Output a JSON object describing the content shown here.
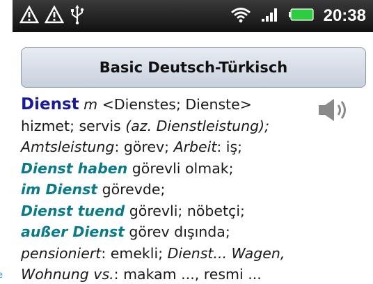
{
  "statusbar": {
    "time": "20:38"
  },
  "left_edge_fragment": "e",
  "app": {
    "title": "Basic Deutsch-Türkisch"
  },
  "entry": {
    "headword": "Dienst",
    "gender": "m",
    "forms": " <Dienstes; Dienste>",
    "l1_a": "hizmet; servis ",
    "l1_b": "(az. Dienstleistung);",
    "l2_a": "Amtsleistung",
    "l2_b": ": görev; ",
    "l2_c": "Arbeit",
    "l2_d": ": iş;",
    "p1": "Dienst haben",
    "p1_t": " görevli olmak;",
    "p2": "im Dienst",
    "p2_t": " görevde;",
    "p3": "Dienst tuend",
    "p3_t": " görevli; nöbetçi;",
    "p4": "außer Dienst",
    "p4_t": " görev dışında;",
    "l7_a": "pensioniert",
    "l7_b": ": emekli; ",
    "l7_c": "Dienst... Wagen,",
    "l8_a": "Wohnung vs.",
    "l8_b": ": makam ..., resmi ..."
  },
  "icons": {
    "status_left": [
      "warning-icon",
      "warning-icon",
      "usb-icon"
    ],
    "status_right": [
      "wifi-icon",
      "signal-icon",
      "battery-icon"
    ],
    "speaker": "speaker-icon"
  },
  "colors": {
    "headword": "#1a1a9a",
    "phrase": "#0a7a8a",
    "battery": "#2ecc40"
  }
}
